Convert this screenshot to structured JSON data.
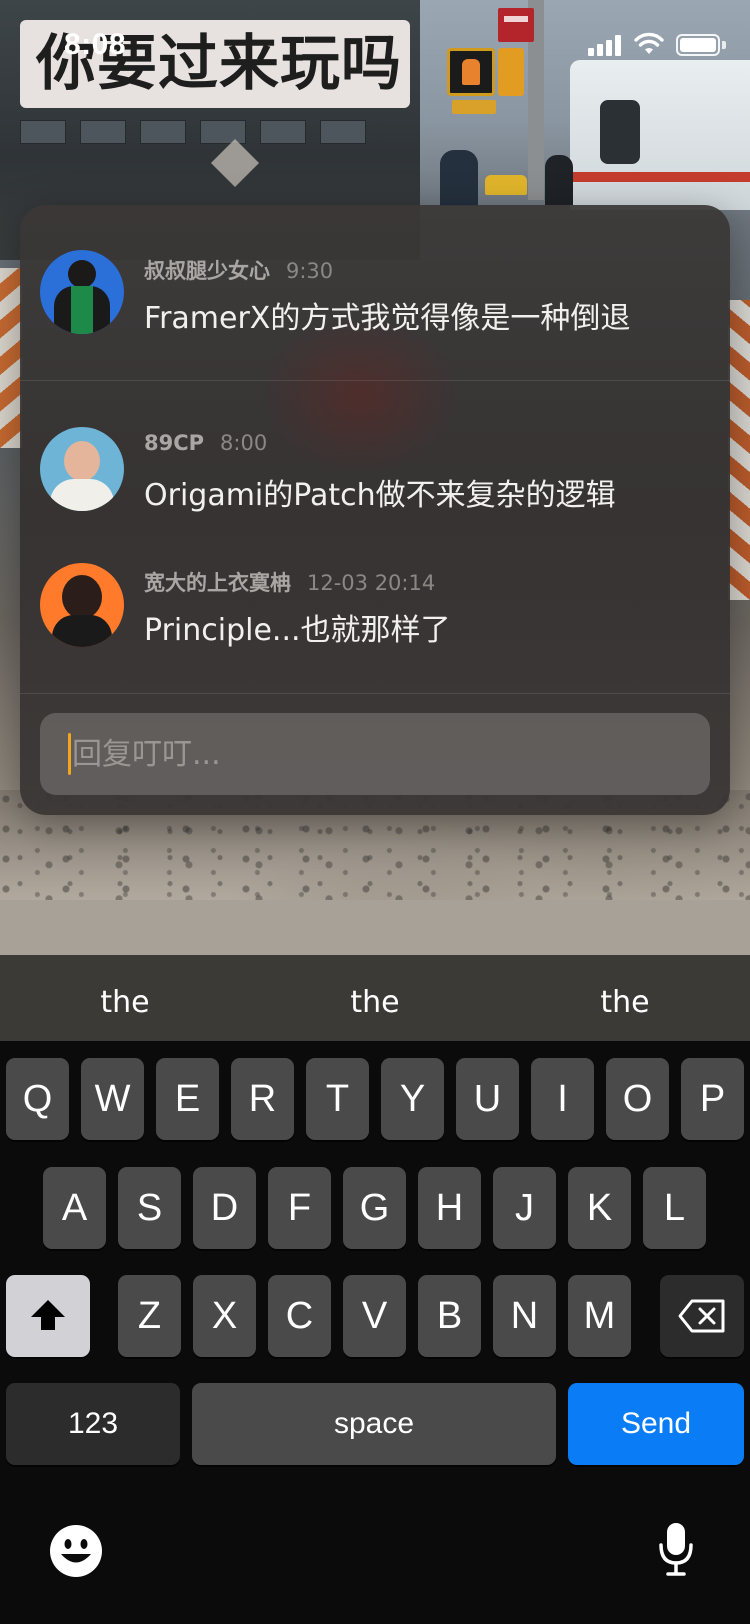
{
  "status_bar": {
    "time": "8:08"
  },
  "title_badge": {
    "text": "你要过来玩吗"
  },
  "comments": [
    {
      "name": "叔叔腿少女心",
      "time": "9:30",
      "text": "FramerX的方式我觉得像是一种倒退",
      "avatar": "avatar-green-hoodie"
    },
    {
      "name": "89CP",
      "time": "8:00",
      "text": "Origami的Patch做不来复杂的逻辑",
      "avatar": "avatar-glasses-man"
    },
    {
      "name": "宽大的上衣寞柟",
      "time": "12-03 20:14",
      "text": "Principle...也就那样了",
      "avatar": "avatar-woman-orange"
    }
  ],
  "reply": {
    "placeholder": "回复叮叮...",
    "value": ""
  },
  "keyboard": {
    "suggestions": [
      "the",
      "the",
      "the"
    ],
    "row1": [
      "Q",
      "W",
      "E",
      "R",
      "T",
      "Y",
      "U",
      "I",
      "O",
      "P"
    ],
    "row2": [
      "A",
      "S",
      "D",
      "F",
      "G",
      "H",
      "J",
      "K",
      "L"
    ],
    "row3": [
      "Z",
      "X",
      "C",
      "V",
      "B",
      "N",
      "M"
    ],
    "numbers_label": "123",
    "space_label": "space",
    "send_label": "Send"
  },
  "colors": {
    "send_button": "#0a7cf5",
    "caret": "#f3a51b",
    "title_badge_bg": "#e7e2df"
  }
}
